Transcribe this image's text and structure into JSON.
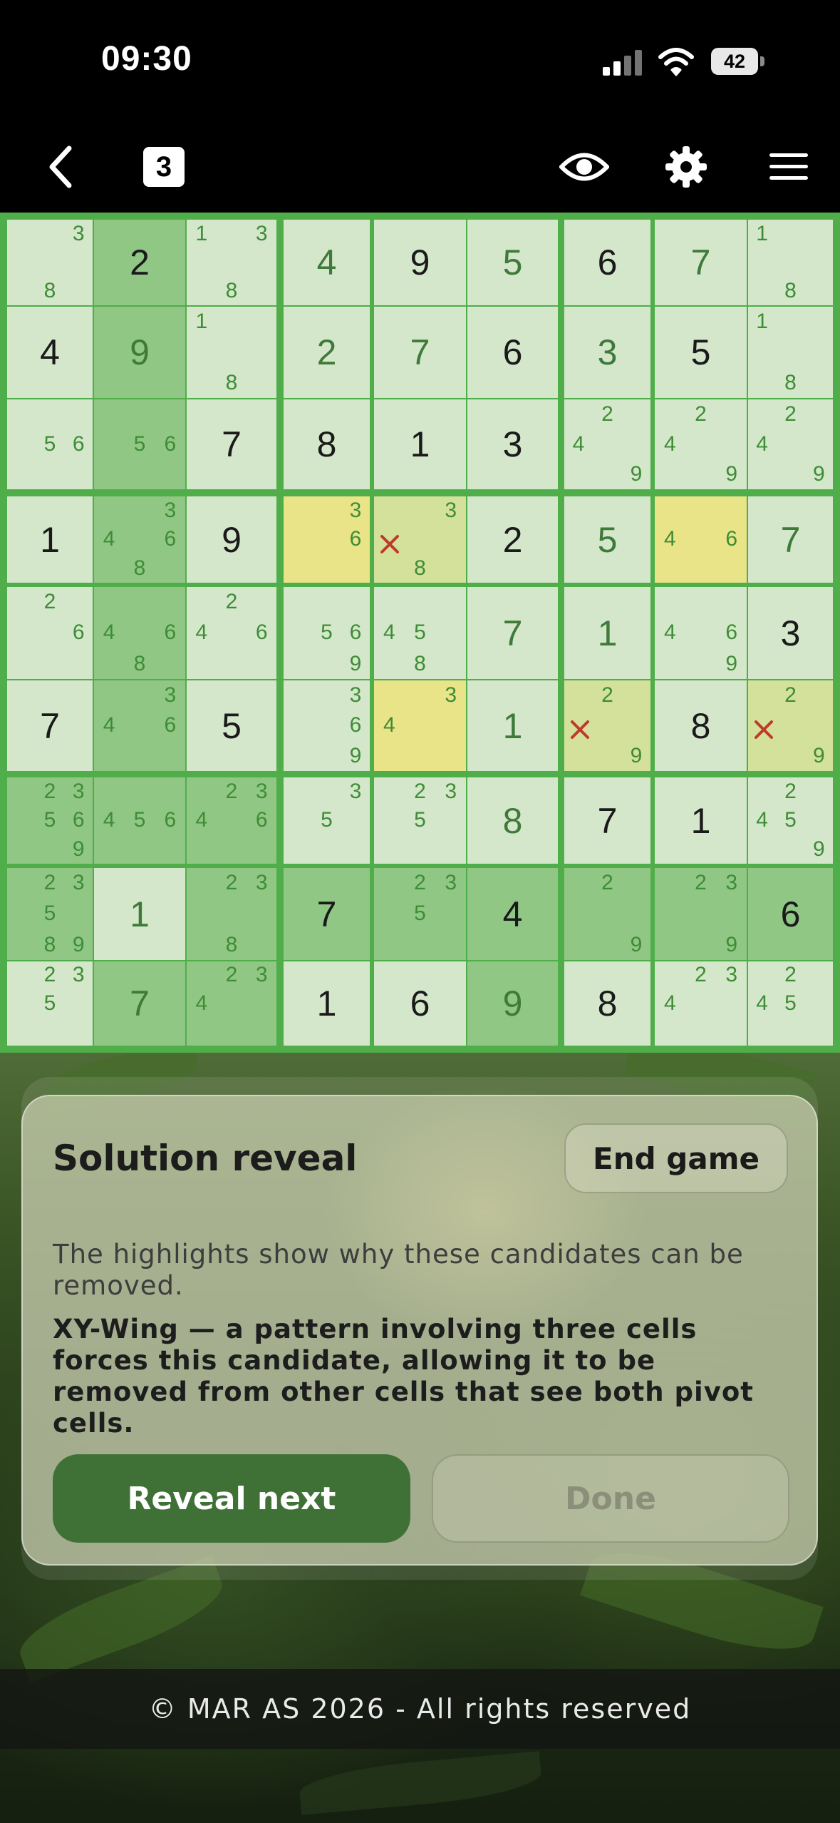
{
  "status_bar": {
    "time": "09:30",
    "battery": "42"
  },
  "top_bar": {
    "level": "3"
  },
  "board": {
    "rows": [
      [
        {
          "c": [
            3,
            8
          ]
        },
        {
          "v": 2,
          "k": "g"
        },
        {
          "c": [
            1,
            3,
            8
          ]
        },
        {
          "v": 4,
          "k": "u"
        },
        {
          "v": 9,
          "k": "g"
        },
        {
          "v": 5,
          "k": "u"
        },
        {
          "v": 6,
          "k": "g"
        },
        {
          "v": 7,
          "k": "u"
        },
        {
          "c": [
            1,
            8
          ]
        }
      ],
      [
        {
          "v": 4,
          "k": "g"
        },
        {
          "v": 9,
          "k": "u"
        },
        {
          "c": [
            1,
            8
          ]
        },
        {
          "v": 2,
          "k": "u"
        },
        {
          "v": 7,
          "k": "u"
        },
        {
          "v": 6,
          "k": "g"
        },
        {
          "v": 3,
          "k": "u"
        },
        {
          "v": 5,
          "k": "g"
        },
        {
          "c": [
            1,
            8
          ]
        }
      ],
      [
        {
          "c": [
            5,
            6
          ]
        },
        {
          "c": [
            5,
            6
          ]
        },
        {
          "v": 7,
          "k": "g"
        },
        {
          "v": 8,
          "k": "g"
        },
        {
          "v": 1,
          "k": "g"
        },
        {
          "v": 3,
          "k": "g"
        },
        {
          "c": [
            2,
            4,
            9
          ]
        },
        {
          "c": [
            2,
            4,
            9
          ]
        },
        {
          "c": [
            2,
            4,
            9
          ]
        }
      ],
      [
        {
          "v": 1,
          "k": "g"
        },
        {
          "c": [
            3,
            4,
            6,
            8
          ]
        },
        {
          "v": 9,
          "k": "g"
        },
        {
          "c": [
            3,
            6
          ],
          "hl": "strong"
        },
        {
          "c": [
            3,
            8
          ],
          "x": [
            4
          ],
          "hl": "soft"
        },
        {
          "v": 2,
          "k": "g"
        },
        {
          "v": 5,
          "k": "u"
        },
        {
          "c": [
            4,
            6
          ],
          "hl": "strong"
        },
        {
          "v": 7,
          "k": "u"
        }
      ],
      [
        {
          "c": [
            2,
            6
          ]
        },
        {
          "c": [
            4,
            6,
            8
          ]
        },
        {
          "c": [
            2,
            4,
            6
          ]
        },
        {
          "c": [
            5,
            6,
            9
          ]
        },
        {
          "c": [
            4,
            5,
            8
          ]
        },
        {
          "v": 7,
          "k": "u"
        },
        {
          "v": 1,
          "k": "u"
        },
        {
          "c": [
            4,
            6,
            9
          ]
        },
        {
          "v": 3,
          "k": "g"
        }
      ],
      [
        {
          "v": 7,
          "k": "g"
        },
        {
          "c": [
            3,
            4,
            6
          ]
        },
        {
          "v": 5,
          "k": "g"
        },
        {
          "c": [
            3,
            6,
            9
          ]
        },
        {
          "c": [
            3,
            4
          ],
          "hl": "strong"
        },
        {
          "v": 1,
          "k": "u"
        },
        {
          "c": [
            2,
            9
          ],
          "x": [
            4
          ],
          "hl": "soft"
        },
        {
          "v": 8,
          "k": "g"
        },
        {
          "c": [
            2,
            9
          ],
          "x": [
            4
          ],
          "hl": "soft"
        }
      ],
      [
        {
          "c": [
            2,
            3,
            5,
            6,
            9
          ]
        },
        {
          "c": [
            4,
            5,
            6
          ]
        },
        {
          "c": [
            2,
            3,
            4,
            6
          ]
        },
        {
          "c": [
            3,
            5
          ]
        },
        {
          "c": [
            2,
            3,
            5
          ]
        },
        {
          "v": 8,
          "k": "u"
        },
        {
          "v": 7,
          "k": "g"
        },
        {
          "v": 1,
          "k": "g"
        },
        {
          "c": [
            2,
            4,
            5,
            9
          ]
        }
      ],
      [
        {
          "c": [
            2,
            3,
            5,
            8,
            9
          ]
        },
        {
          "v": 1,
          "k": "u"
        },
        {
          "c": [
            2,
            3,
            8
          ]
        },
        {
          "v": 7,
          "k": "g"
        },
        {
          "c": [
            2,
            3,
            5
          ]
        },
        {
          "v": 4,
          "k": "g"
        },
        {
          "c": [
            2,
            9
          ]
        },
        {
          "c": [
            2,
            3,
            9
          ]
        },
        {
          "v": 6,
          "k": "g"
        }
      ],
      [
        {
          "c": [
            2,
            3,
            5
          ]
        },
        {
          "v": 7,
          "k": "u"
        },
        {
          "c": [
            2,
            3,
            4
          ]
        },
        {
          "v": 1,
          "k": "g"
        },
        {
          "v": 6,
          "k": "g"
        },
        {
          "v": 9,
          "k": "u"
        },
        {
          "v": 8,
          "k": "g"
        },
        {
          "c": [
            2,
            3,
            4
          ]
        },
        {
          "c": [
            2,
            4,
            5
          ]
        }
      ]
    ],
    "dim_cells": [
      "0-1",
      "1-1",
      "2-1",
      "3-1",
      "4-1",
      "5-1",
      "6-0",
      "6-1",
      "6-2",
      "7-0",
      "7-2",
      "7-3",
      "7-4",
      "7-5",
      "7-6",
      "7-7",
      "7-8",
      "8-1",
      "8-2",
      "8-5"
    ]
  },
  "panel": {
    "title": "Solution reveal",
    "end_game_label": "End game",
    "description": "The highlights show why these candidates can be removed.",
    "explanation": "XY-Wing — a pattern involving three cells forces this candidate, allowing it to be removed from other cells that see both pivot cells.",
    "reveal_next_label": "Reveal next",
    "done_label": "Done",
    "done_enabled": false
  },
  "footer": {
    "text": "© MAR AS 2026 - All rights reserved"
  },
  "colors": {
    "board_border": "#4fae4a",
    "given_digit": "#1a1a1a",
    "user_digit": "#3f7a3a",
    "candidate": "#3e8c36",
    "highlight": "#f6e88c",
    "eliminated_mark": "#c0392b",
    "primary_button": "#3f7136"
  }
}
